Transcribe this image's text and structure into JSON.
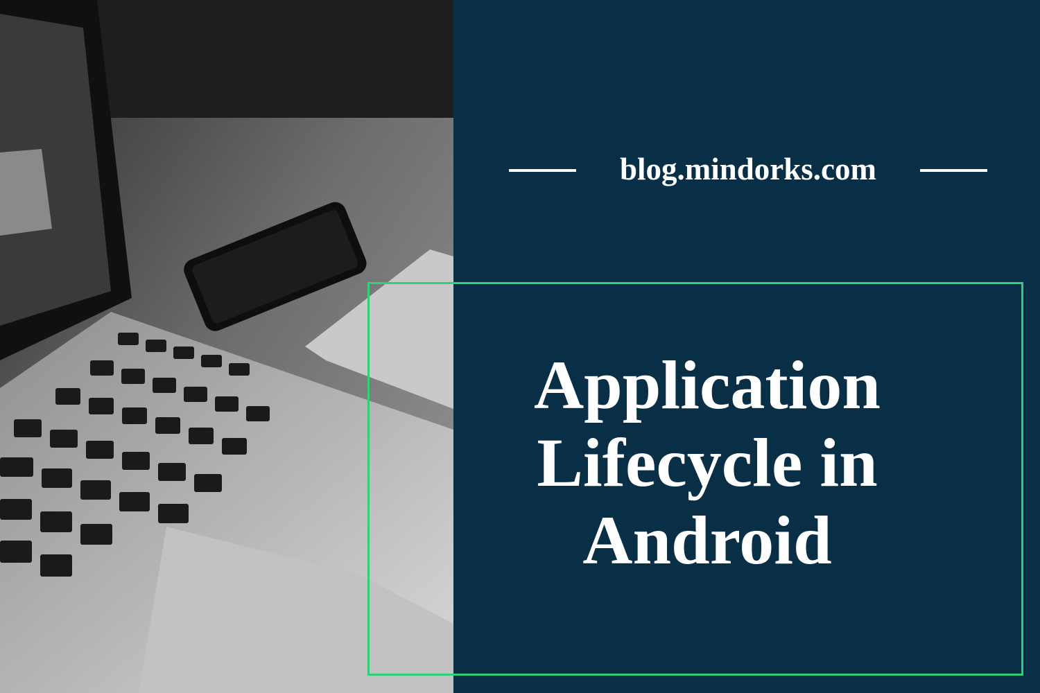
{
  "banner": {
    "site": "blog.mindorks.com",
    "title_lines": [
      "Application",
      "Lifecycle in",
      "Android"
    ]
  },
  "photo": {
    "description_icon": "laptop-phone-photo-icon"
  },
  "colors": {
    "panel": "#082f45",
    "accent": "#2fd07a",
    "text": "#ffffff"
  }
}
